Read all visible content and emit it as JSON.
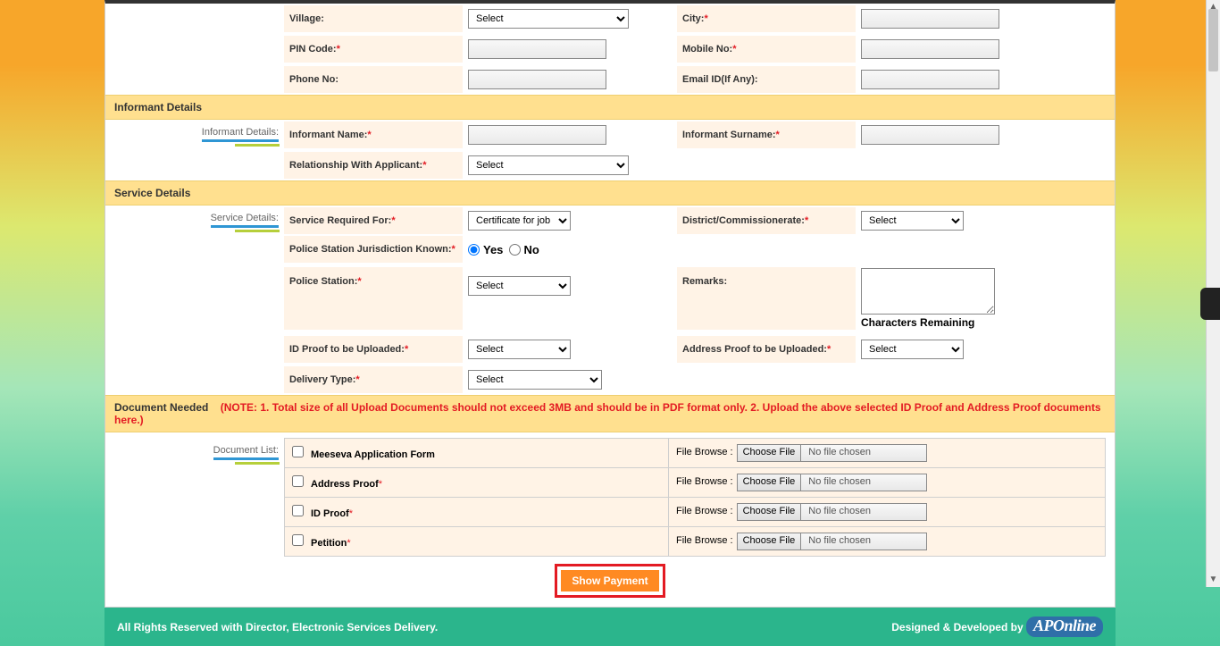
{
  "address": {
    "village_label": "Village:",
    "village_value": "Select",
    "city_label": "City:",
    "pin_label": "PIN Code:",
    "mobile_label": "Mobile No:",
    "phone_label": "Phone No:",
    "email_label": "Email ID(If Any):"
  },
  "informant": {
    "section_title": "Informant Details",
    "side_label": "Informant Details:",
    "name_label": "Informant Name:",
    "surname_label": "Informant Surname:",
    "relationship_label": "Relationship With Applicant:",
    "relationship_value": "Select"
  },
  "service": {
    "section_title": "Service Details",
    "side_label": "Service Details:",
    "required_for_label": "Service Required For:",
    "required_for_value": "Certificate for job",
    "district_label": "District/Commissionerate:",
    "district_value": "Select",
    "jurisdiction_label": "Police Station Jurisdiction Known:",
    "radio_yes": "Yes",
    "radio_no": "No",
    "police_station_label": "Police Station:",
    "police_station_value": "Select",
    "remarks_label": "Remarks:",
    "chars_remaining": "Characters Remaining",
    "id_proof_label": "ID Proof to be Uploaded:",
    "id_proof_value": "Select",
    "addr_proof_label": "Address Proof to be Uploaded:",
    "addr_proof_value": "Select",
    "delivery_label": "Delivery Type:",
    "delivery_value": "Select"
  },
  "documents": {
    "section_title": "Document Needed",
    "note": "(NOTE: 1. Total size of all Upload Documents should not exceed 3MB and should be in PDF format only. 2. Upload the above selected ID Proof and Address Proof documents here.)",
    "side_label": "Document List:",
    "file_browse_label": "File Browse :",
    "choose_file": "Choose File",
    "no_file": "No file chosen",
    "rows": [
      {
        "label": "Meeseva Application Form",
        "required": false
      },
      {
        "label": "Address Proof",
        "required": true
      },
      {
        "label": "ID Proof",
        "required": true
      },
      {
        "label": "Petition",
        "required": true
      }
    ]
  },
  "actions": {
    "show_payment": "Show Payment"
  },
  "footer": {
    "left": "All Rights Reserved with Director, Electronic Services Delivery.",
    "right_prefix": "Designed & Developed by",
    "logo": "APOnline"
  }
}
